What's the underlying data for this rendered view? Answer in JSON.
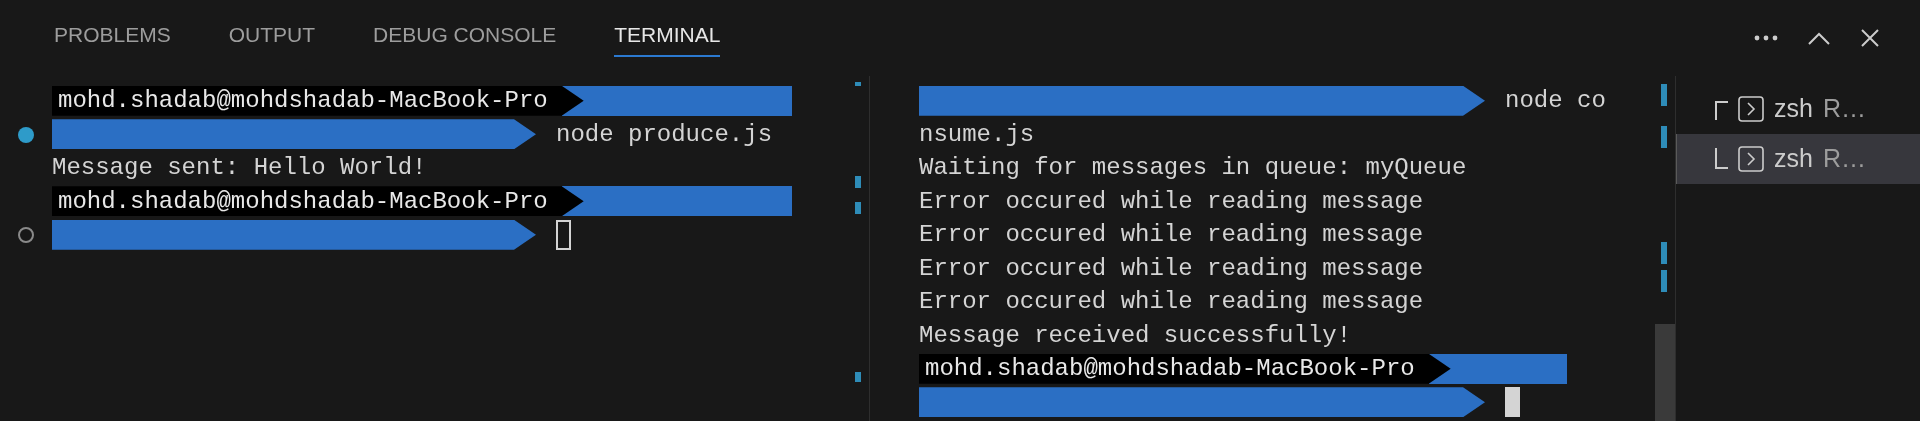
{
  "tabs": [
    {
      "label": "PROBLEMS",
      "selected": false
    },
    {
      "label": "OUTPUT",
      "selected": false
    },
    {
      "label": "DEBUG CONSOLE",
      "selected": false
    },
    {
      "label": "TERMINAL",
      "selected": true
    }
  ],
  "panes": [
    {
      "focused": false,
      "lines": [
        {
          "kind": "prompt",
          "text": "mohd.shadab@mohdshadab-MacBook-Pro"
        },
        {
          "kind": "path",
          "success": true,
          "command": "node produce.js"
        },
        {
          "kind": "output",
          "text": "Message sent: Hello World!"
        },
        {
          "kind": "prompt",
          "text": "mohd.shadab@mohdshadab-MacBook-Pro"
        },
        {
          "kind": "path",
          "success": false,
          "cursor": true
        }
      ]
    },
    {
      "focused": true,
      "lines": [
        {
          "kind": "path",
          "command": "node co"
        },
        {
          "kind": "output",
          "text": "nsume.js"
        },
        {
          "kind": "output",
          "text": "Waiting for messages in queue: myQueue"
        },
        {
          "kind": "output",
          "text": "Error occured while reading message"
        },
        {
          "kind": "output",
          "text": "Error occured while reading message"
        },
        {
          "kind": "output",
          "text": "Error occured while reading message"
        },
        {
          "kind": "output",
          "text": "Error occured while reading message"
        },
        {
          "kind": "output",
          "text": "Message received successfully!"
        },
        {
          "kind": "prompt",
          "text": "mohd.shadab@mohdshadab-MacBook-Pro"
        },
        {
          "kind": "path",
          "cursor": true
        }
      ]
    }
  ],
  "terminals": [
    {
      "name": "zsh",
      "detail": "R…",
      "selected": false
    },
    {
      "name": "zsh",
      "detail": "R…",
      "selected": true
    }
  ]
}
